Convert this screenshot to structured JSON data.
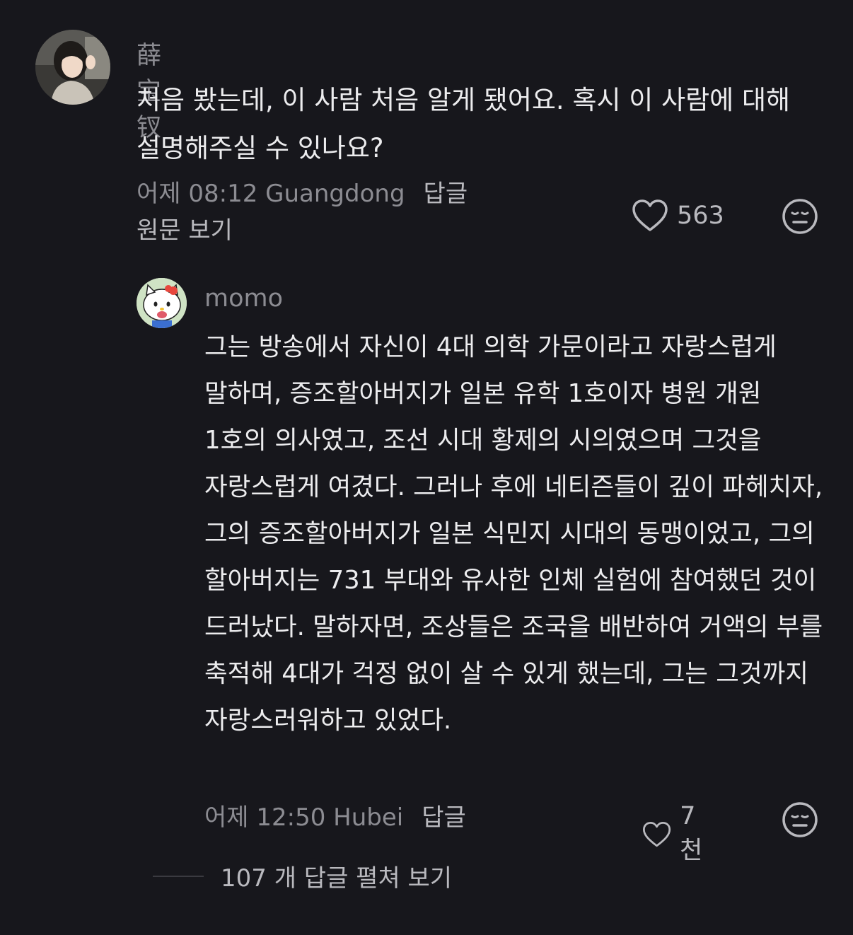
{
  "comments": [
    {
      "username": "薛宝钗",
      "text": "처음 봤는데, 이 사람 처음 알게 됐어요. 혹시 이 사람에 대해 설명해주실 수 있나요?",
      "timestamp": "어제 08:12 Guangdong",
      "reply_label": "답글",
      "translate_label": "원문 보기",
      "like_count": "563",
      "avatar_icon": "profile-photo",
      "like_icon": "heart-outline-icon",
      "dislike_icon": "meh-face-icon"
    },
    {
      "username": "momo",
      "text": "그는 방송에서 자신이 4대 의학 가문이라고 자랑스럽게 말하며, 증조할아버지가 일본 유학 1호이자 병원 개원 1호의 의사였고, 조선 시대 황제의 시의였으며 그것을 자랑스럽게 여겼다. 그러나 후에 네티즌들이 깊이 파헤치자, 그의 증조할아버지가 일본 식민지 시대의 동맹이었고, 그의 할아버지는 731 부대와 유사한 인체 실험에 참여했던 것이 드러났다. 말하자면, 조상들은 조국을 배반하여 거액의 부를 축적해 4대가 걱정 없이 살 수 있게 했는데, 그는 그것까지 자랑스러워하고 있었다.",
      "timestamp": "어제 12:50 Hubei",
      "reply_label": "답글",
      "like_count": "7천",
      "avatar_icon": "hello-kitty-avatar",
      "like_icon": "heart-outline-icon",
      "dislike_icon": "meh-face-icon"
    }
  ],
  "expand_replies": "107 개 답글 펼쳐 보기",
  "colors": {
    "background": "#17171c",
    "text_primary": "#ececee",
    "text_secondary": "#8c8c92",
    "icon": "#b9b9be"
  }
}
